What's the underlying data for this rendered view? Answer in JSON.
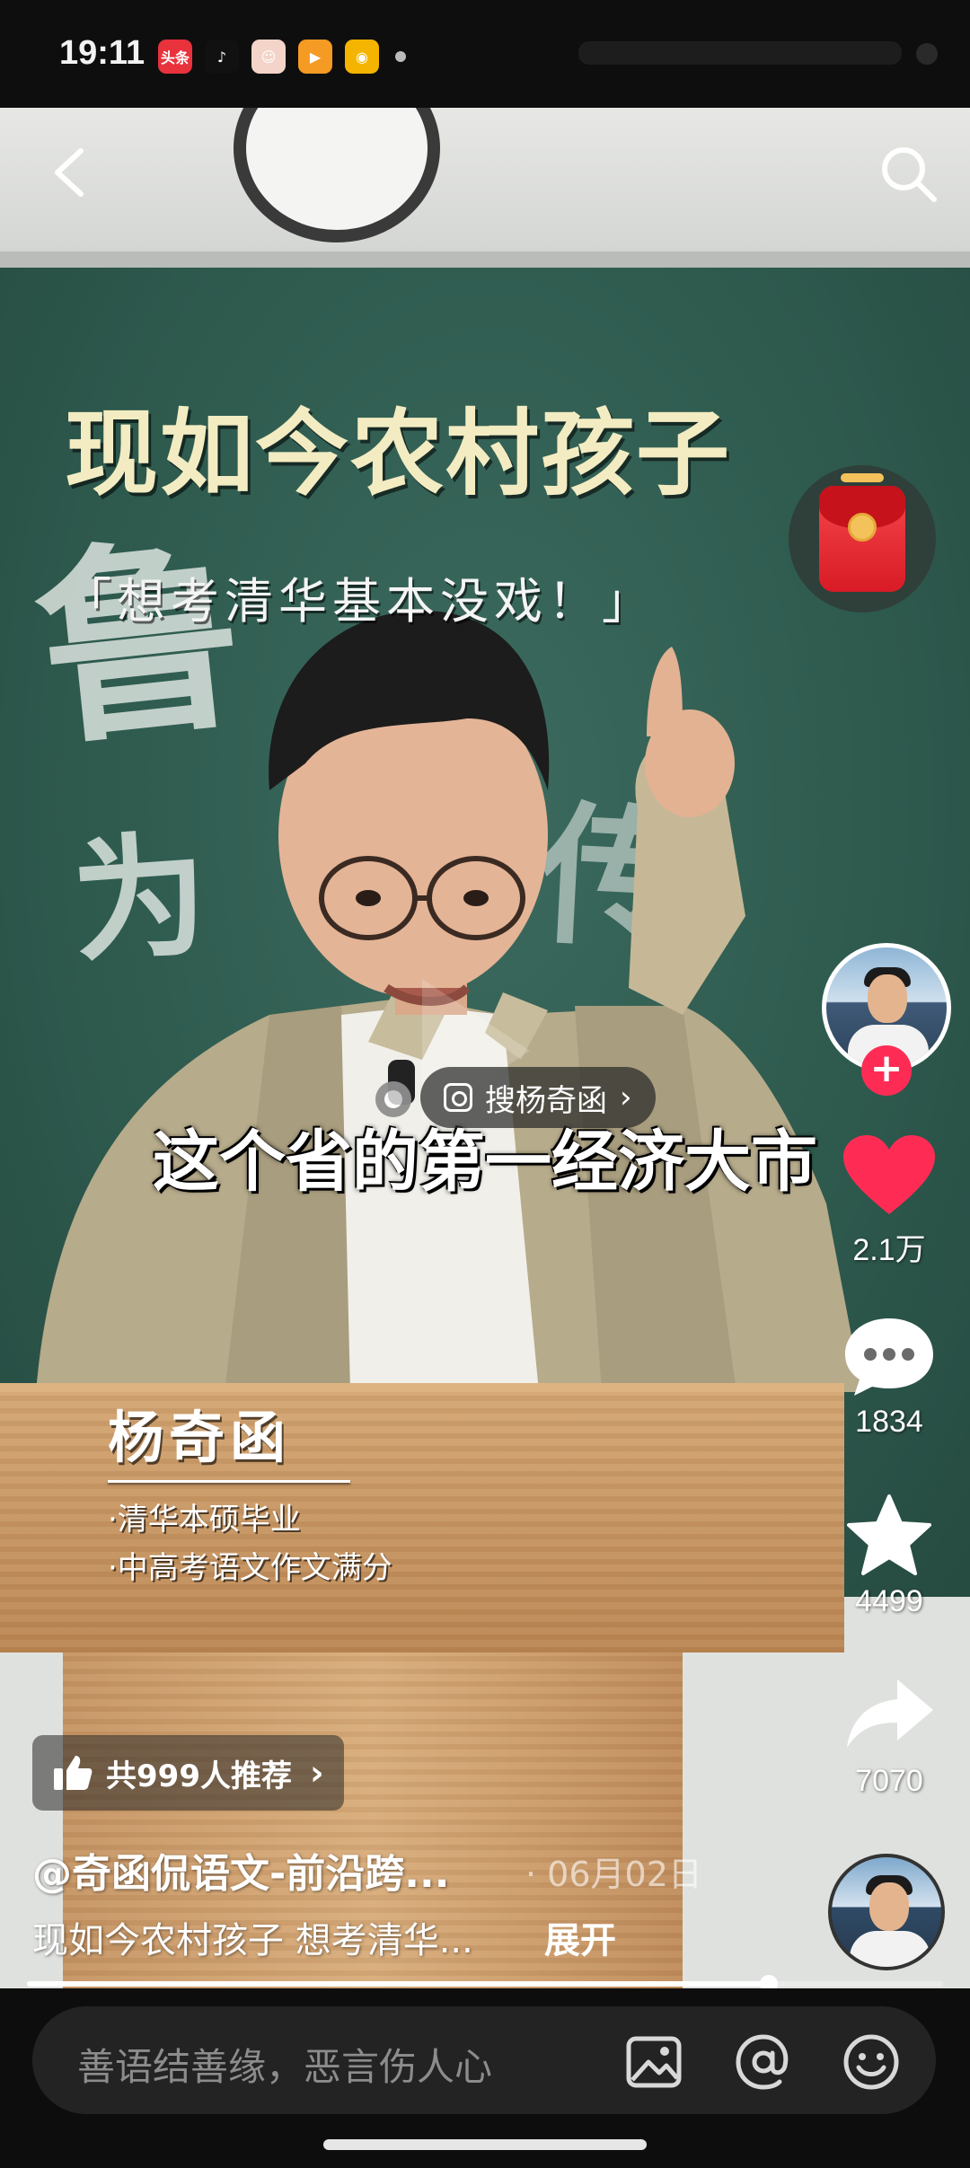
{
  "status_bar": {
    "time": "19:11",
    "apps": [
      {
        "name": "toutiao-icon",
        "label": "头条",
        "color": "#e8323c"
      },
      {
        "name": "tiktok-icon",
        "label": "♪",
        "color": "#111111"
      },
      {
        "name": "avatar-app-icon",
        "label": "☺",
        "color": "#f4d4c8"
      },
      {
        "name": "video-app-icon",
        "label": "▶",
        "color": "#f59a23"
      },
      {
        "name": "weibo-icon",
        "label": "◉",
        "color": "#f4b400"
      }
    ]
  },
  "video": {
    "headline": "现如今农村孩子",
    "subline": "「想考清华基本没戏！」",
    "chalk_text_1": "鲁",
    "chalk_text_2": "为",
    "chalk_text_3": "传",
    "caption": "这个省的第一经济大市",
    "search_chip": "搜杨奇函",
    "lower_third": {
      "name": "杨奇函",
      "line1": "·清华本硕毕业",
      "line2": "·中高考语文作文满分"
    }
  },
  "rail": {
    "like_count": "2.1万",
    "comment_count": "1834",
    "favorite_count": "4499",
    "share_count": "7070",
    "follow_symbol": "+"
  },
  "post": {
    "recommend_label": "共999人推荐",
    "author": "@奇函侃语文-前沿跨...",
    "date": "· 06月02日",
    "description": "现如今农村孩子 想考清华...",
    "expand_label": "展开",
    "progress": 0.81
  },
  "comment_bar": {
    "placeholder": "善语结善缘，恶言伤人心"
  },
  "colors": {
    "accent": "#fe2c55",
    "like_heart": "#fe2c55"
  }
}
